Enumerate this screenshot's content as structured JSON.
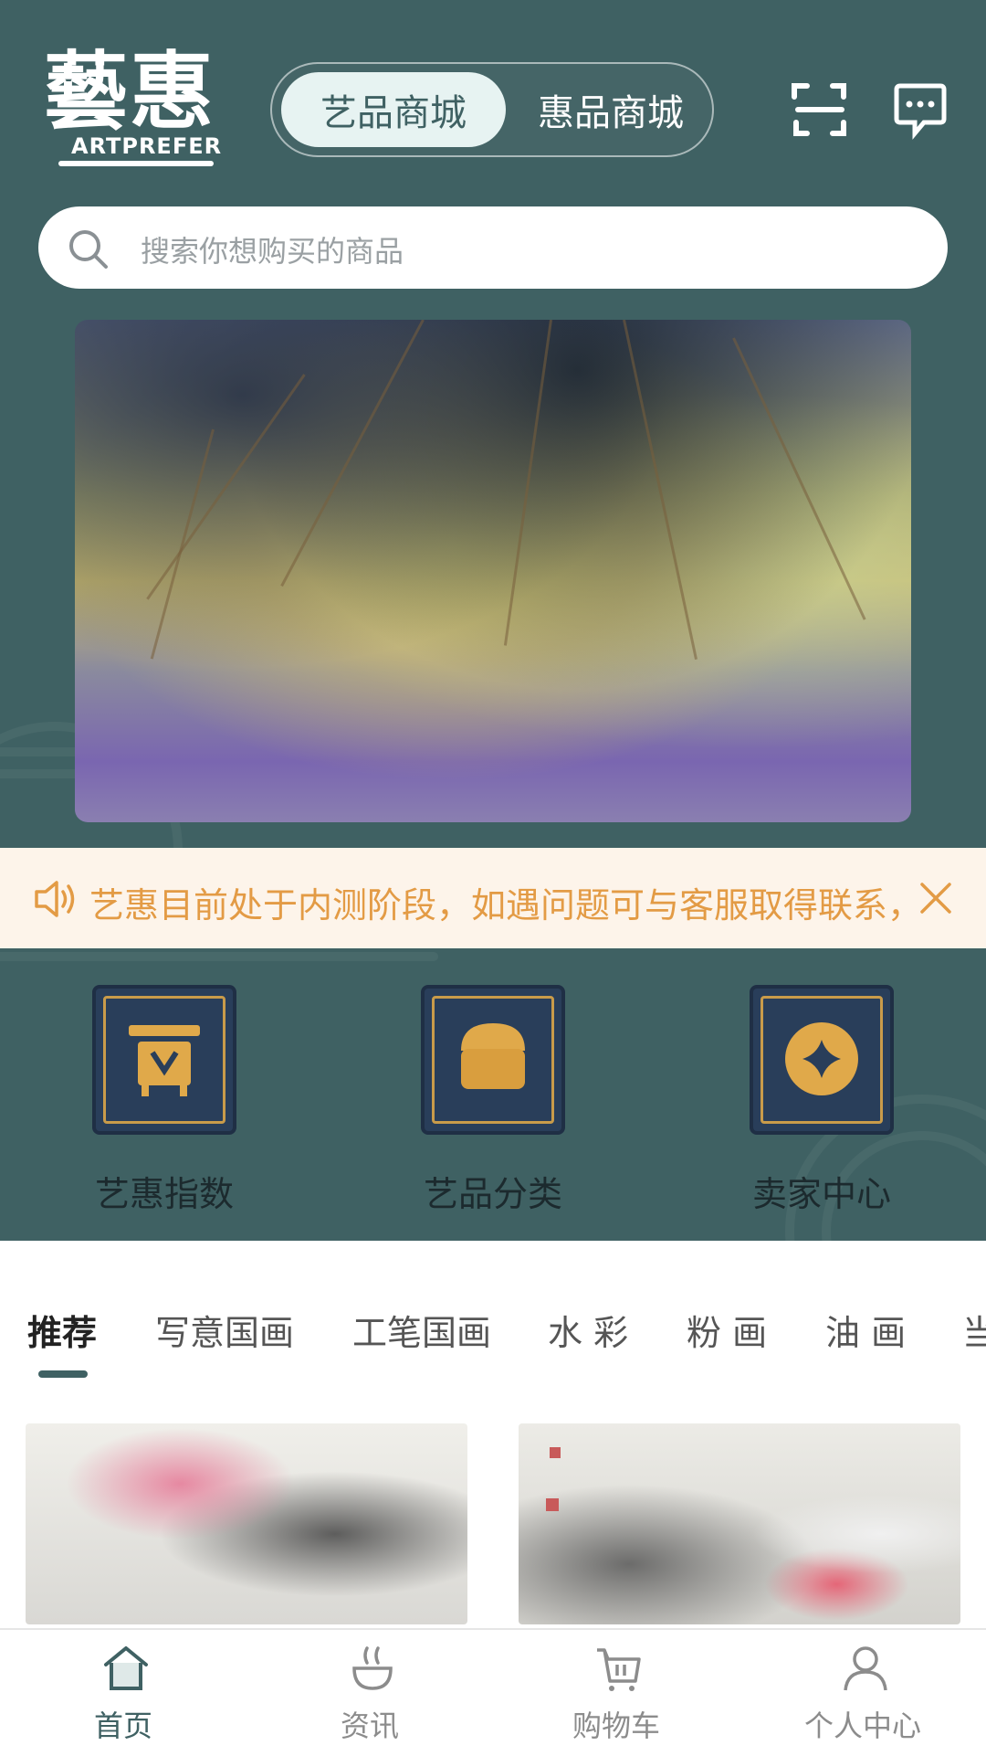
{
  "header": {
    "logo_cn": "藝惠",
    "logo_en": "ARTPREFER",
    "tabs": [
      "艺品商城",
      "惠品商城"
    ],
    "active_tab": "艺品商城",
    "icons": [
      "scan-icon",
      "message-icon"
    ]
  },
  "search": {
    "placeholder": "搜索你想购买的商品"
  },
  "notice": {
    "text": "艺惠目前处于内测阶段，如遇问题可与客服取得联系，"
  },
  "categories": [
    {
      "label": "艺惠指数",
      "icon": "vessel-icon"
    },
    {
      "label": "艺品分类",
      "icon": "shop-icon"
    },
    {
      "label": "卖家中心",
      "icon": "coin-icon"
    }
  ],
  "category_tabs": [
    "推荐",
    "写意国画",
    "工笔国画",
    "水 彩",
    "粉 画",
    "油 画",
    "当"
  ],
  "active_category_tab": "推荐",
  "bottom_nav": [
    {
      "label": "首页",
      "icon": "home-icon"
    },
    {
      "label": "资讯",
      "icon": "news-icon"
    },
    {
      "label": "购物车",
      "icon": "cart-icon"
    },
    {
      "label": "个人中心",
      "icon": "person-icon"
    }
  ],
  "colors": {
    "brand": "#3f6163",
    "notice_bg": "#fdf4ea",
    "notice_text": "#e39b45",
    "tile_gold": "#c99b4a"
  }
}
